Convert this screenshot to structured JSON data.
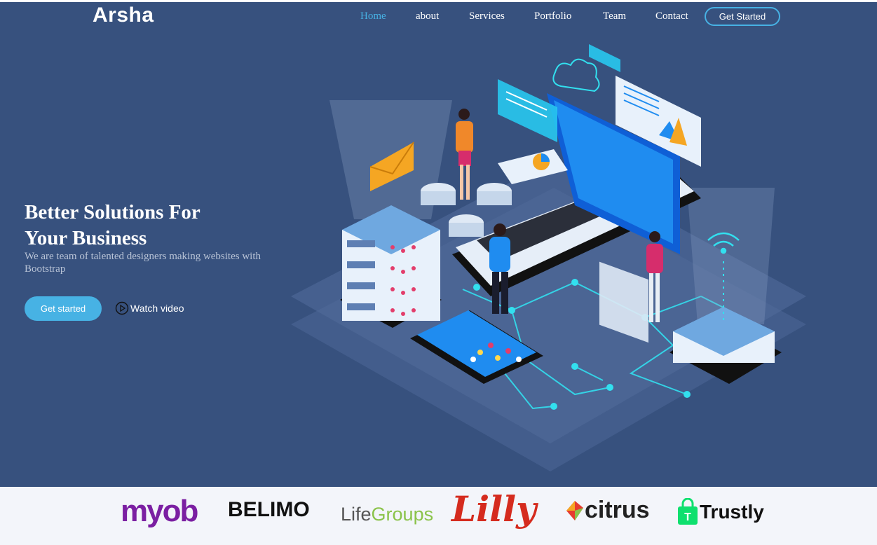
{
  "brand": {
    "name": "Arsha"
  },
  "nav": {
    "items": [
      {
        "label": "Home",
        "active": true
      },
      {
        "label": "about"
      },
      {
        "label": "Services"
      },
      {
        "label": "Portfolio"
      },
      {
        "label": "Team"
      },
      {
        "label": "Contact"
      }
    ],
    "cta": "Get Started"
  },
  "hero": {
    "title_line1": "Better Solutions For",
    "title_line2": "Your Business",
    "subtitle": "We are team of talented designers making websites with Bootstrap",
    "primary_button": "Get started",
    "video_link": "Watch video",
    "illustration_icon": "isometric-tech-illustration"
  },
  "clients": {
    "myob": "myob",
    "belimo": "BELIMO",
    "lifegroups_life": "Life",
    "lifegroups_groups": "Groups",
    "lilly": "Lilly",
    "citrus": "citrus",
    "trustly": "Trustly"
  },
  "colors": {
    "hero_bg": "#37517e",
    "accent": "#47b2e4",
    "clients_bg": "#f3f5fa"
  }
}
